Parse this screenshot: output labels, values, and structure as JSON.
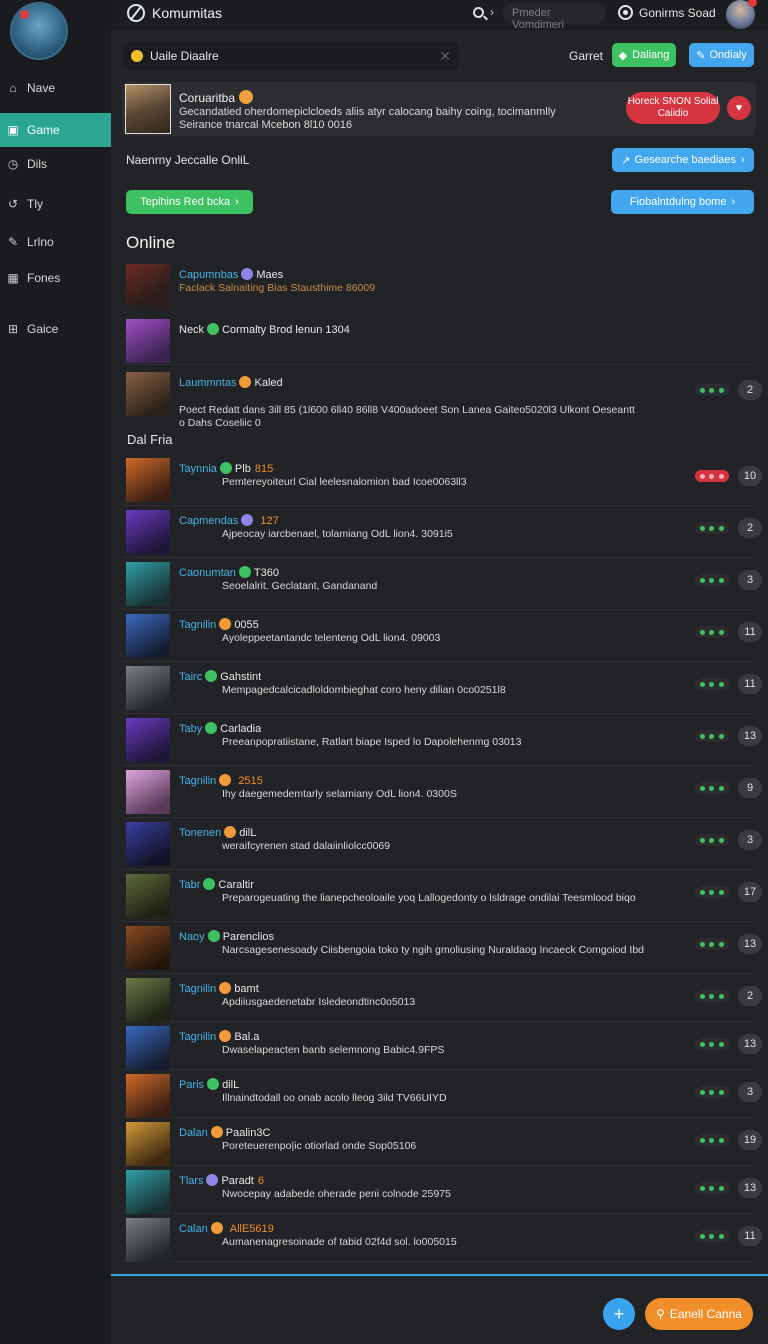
{
  "app": {
    "title": "Komumitas"
  },
  "topbar": {
    "search_placeholder": "Pmeder Vomdimeri",
    "user_name": "Gonirms Soad"
  },
  "sidebar": {
    "items": [
      {
        "label": "Nave",
        "icon": "home-icon"
      },
      {
        "label": "Game",
        "icon": "controller-icon",
        "active": true
      },
      {
        "label": "Dils",
        "icon": "clock-icon"
      },
      {
        "label": "Tly",
        "icon": "history-icon"
      },
      {
        "label": "Lrlno",
        "icon": "pen-icon"
      },
      {
        "label": "Fones",
        "icon": "grid-icon"
      },
      {
        "label": "Gaice",
        "icon": "gift-icon"
      }
    ]
  },
  "status": {
    "value": "Uaile Diaalre",
    "cancel_label": "Garret",
    "btn_green": "Daliang",
    "btn_blue": "Ondialy"
  },
  "feature": {
    "title": "Coruaritba",
    "desc": "Gecandatied oherdomepiclcloeds aliis atyr calocang baihy coing, tocimanmlly Seirance tnarcal Mcebon 8l10 0016",
    "pill": "Horeck SNON Solial Caiidio"
  },
  "recent": {
    "label": "Naenrny Jeccalle OnliL",
    "btn_right": "Gesearche baediaes",
    "btn_green": "Tepihins Red bcka",
    "btn_blue": "Fiobalntdulng bome"
  },
  "sections": {
    "online": "Online",
    "fria": "Dal Fria"
  },
  "colors": {
    "accent_green": "#3ec162",
    "accent_blue": "#43a7ef",
    "accent_red": "#d63440",
    "accent_orange": "#f08f2a",
    "active_nav": "#2aa692"
  },
  "online": [
    {
      "name": "Capumnbas",
      "game": "Maes",
      "desc": "Faclack Salnaiting Bias Stausthime 86009",
      "desc_color": "#d89b4c",
      "status": "purple",
      "thumb": "red"
    },
    {
      "name": "",
      "game": "Neck",
      "game_after": "Cormalty Brod lenun 1304",
      "desc": "",
      "status": "green",
      "thumb": "purple"
    },
    {
      "name": "Laummntas",
      "game": "Kaled",
      "desc": "Poect Redatt dans 3ill 85 (1l600 6ll40 86ll8 V400adoeet Son Lanea Gaiteo5020l3 Ulkont Oeseantt o Dahs Coseliic 0",
      "status": "orange",
      "thumb": "bronze",
      "dots": "green",
      "count": "2"
    }
  ],
  "friends": [
    {
      "name": "Taynnia",
      "tag": "Plb",
      "level": "815",
      "desc": "Pemtereyoiteurl Cial leelesnalomion bad Icoe0063ll3",
      "status": "green",
      "thumb": "orange",
      "dots": "red",
      "count": "10"
    },
    {
      "name": "Capmendas",
      "level": "127",
      "desc": "Ajpeocay iarcbenael, tolamiang OdL lion4. 3091i5",
      "status": "purple",
      "thumb": "violet",
      "dots": "green",
      "count": "2"
    },
    {
      "name": "Caonumtan",
      "tag": "T360",
      "desc": "Seoelalrit. Geclatant, Gandanand",
      "status": "green",
      "thumb": "teal",
      "dots": "green",
      "count": "3"
    },
    {
      "name": "Tagnilin",
      "tag": "0055",
      "desc": "Ayoleppeetantandc telenteng OdL lion4. 09003",
      "status": "orange",
      "thumb": "blue",
      "dots": "green",
      "count": "11"
    },
    {
      "name": "Tairc",
      "tag": "Gahstint",
      "desc": "Mempagedcalcicadloldombieghat coro heny dilian 0co0251l8",
      "status": "green",
      "thumb": "grey",
      "dots": "green",
      "count": "11"
    },
    {
      "name": "Taby",
      "tag": "Carladia",
      "desc": "Preeanpopratiistane, Ratlart biape Isped lo Dapolehenmg 03013",
      "status": "green",
      "thumb": "violet",
      "dots": "green",
      "count": "13"
    },
    {
      "name": "Tagnilin",
      "level": "2515",
      "desc": "Ihy daegemedemtarly selamiany OdL lion4. 0300S",
      "status": "orange",
      "thumb": "pink",
      "dots": "green",
      "count": "9"
    },
    {
      "name": "Tonenen",
      "tag": "dilL",
      "desc": "weraifcyrenen stad dalaiinliolcc0069",
      "status": "orange",
      "thumb": "navy",
      "dots": "green",
      "count": "3"
    },
    {
      "name": "Tabr",
      "tag": "Caraltir",
      "desc": "Preparogeuating the lianepcheoloaile yoq Lallogedonty o lsldrage ondilai Teesmlood biqo",
      "status": "green",
      "thumb": "olive",
      "dots": "green",
      "count": "17"
    },
    {
      "name": "Naoy",
      "tag": "Parenclios",
      "desc": "Narcsagesenesoady Ciisbengoia toko ty ngih gmoliusing Nuraldaog Incaeck Comgoiod Ibd",
      "status": "green",
      "thumb": "brown",
      "dots": "green",
      "count": "13"
    },
    {
      "name": "Tagnilin",
      "tag": "bamt",
      "desc": "Apdiiusgaedenetabr Isledeondtinc0o5013",
      "status": "orange",
      "thumb": "moss",
      "dots": "green",
      "count": "2"
    },
    {
      "name": "Tagnilin",
      "tag": "Bal.a",
      "desc": "Dwaselapeacten banb selemnong Babic4.9FPS",
      "status": "orange",
      "thumb": "blue",
      "dots": "green",
      "count": "13"
    },
    {
      "name": "Paris",
      "tag": "dilL",
      "desc": "Illnaindtodall oo onab acolo lleog 3ild TV66UIYD",
      "status": "green",
      "thumb": "orange",
      "dots": "green",
      "count": "3"
    },
    {
      "name": "Dalan",
      "tag": "Paalin3C",
      "desc": "Poreteuerenpo|ic otiorlad onde Sop05106",
      "status": "orange",
      "thumb": "gold",
      "dots": "green",
      "count": "19"
    },
    {
      "name": "Tlars",
      "tag": "Paradt",
      "level": "6",
      "desc": "Nwocepay adabede oherade peni colnode 25975",
      "status": "purple",
      "thumb": "teal",
      "dots": "green",
      "count": "13"
    },
    {
      "name": "Calan",
      "level": "AllE5619",
      "desc": "Aumanenagresoinade of tabid 02f4d sol. lo005015",
      "status": "orange",
      "thumb": "grey",
      "dots": "green",
      "count": "11"
    }
  ],
  "bottom": {
    "cta_label": "Eanell Canna",
    "add_symbol": "+"
  }
}
